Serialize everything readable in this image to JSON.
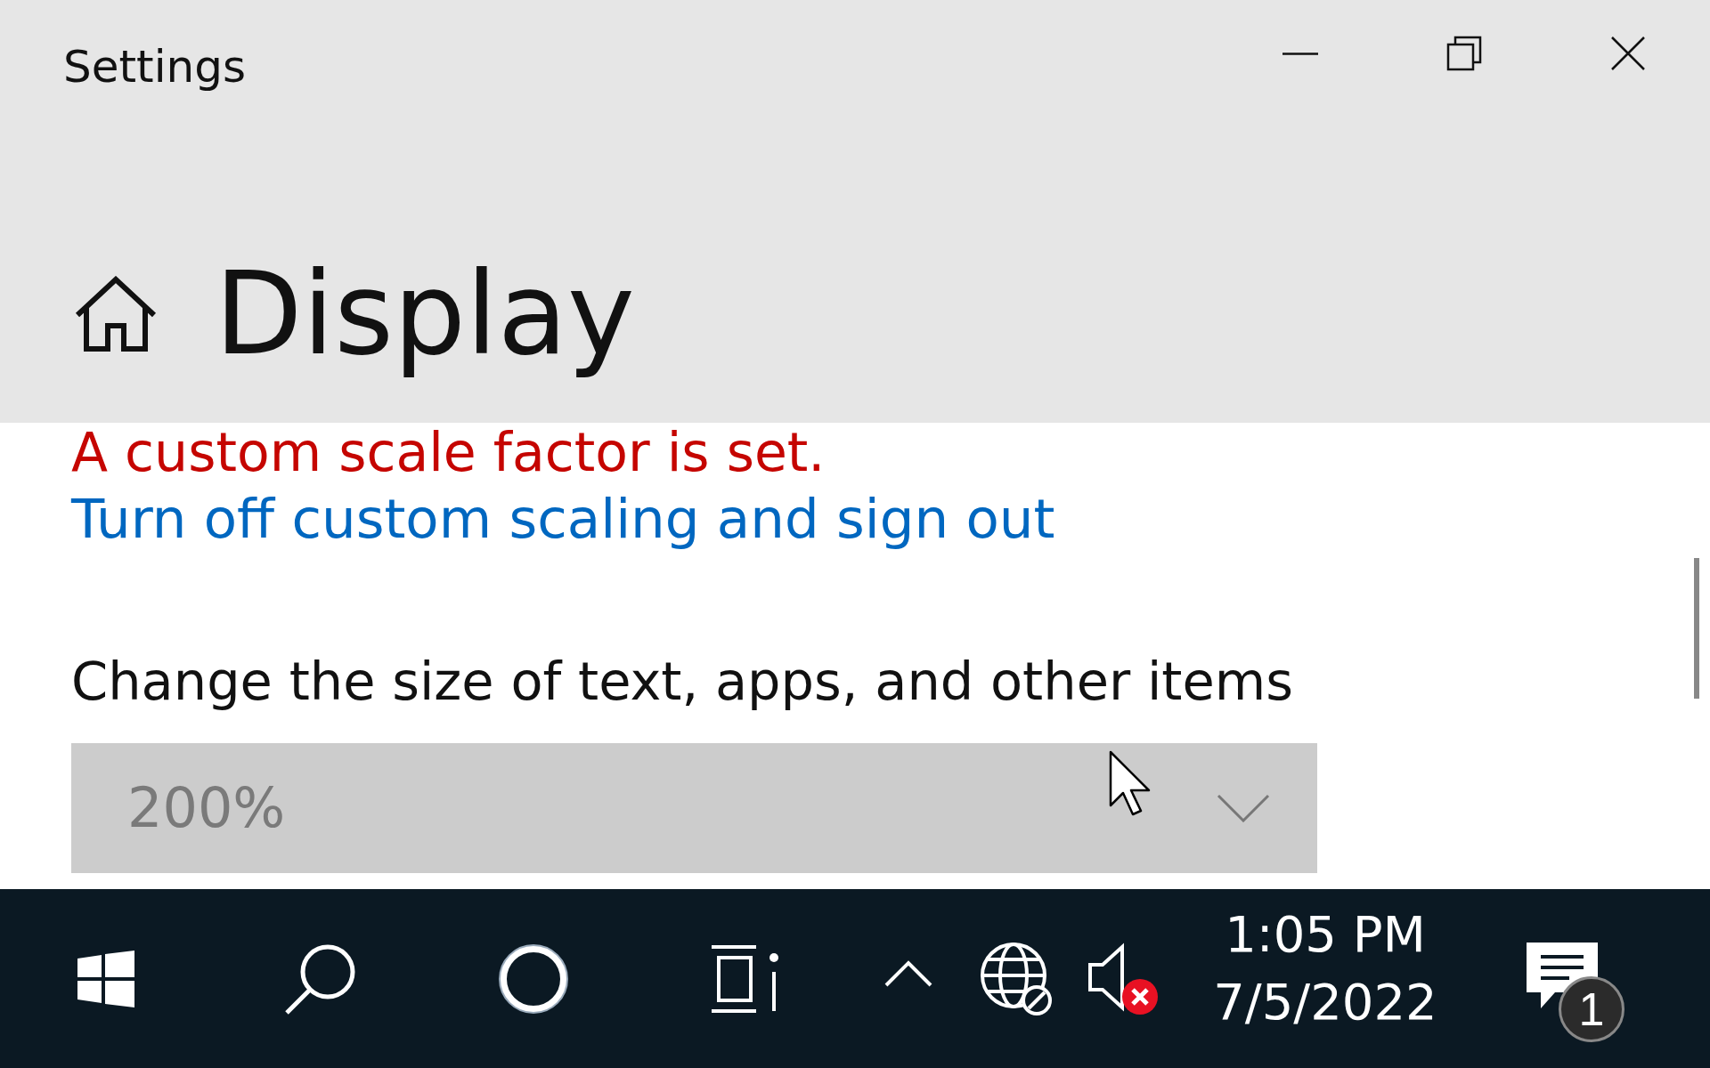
{
  "window": {
    "title": "Settings"
  },
  "page": {
    "title": "Display"
  },
  "content": {
    "warning": "A custom scale factor is set.",
    "link": "Turn off custom scaling and sign out",
    "scale_label": "Change the size of text, apps, and other items",
    "scale_dropdown": {
      "value": "200%",
      "disabled": true
    }
  },
  "taskbar": {
    "time": "1:05 PM",
    "date": "7/5/2022",
    "notification_count": "1",
    "volume": {
      "muted": true
    }
  }
}
